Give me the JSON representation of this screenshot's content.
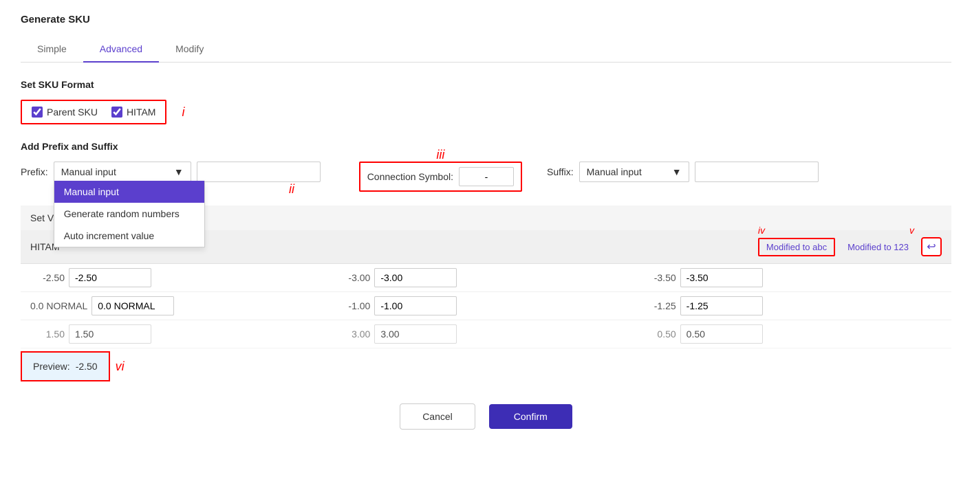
{
  "dialog": {
    "title": "Generate SKU"
  },
  "tabs": {
    "items": [
      {
        "id": "simple",
        "label": "Simple",
        "active": false
      },
      {
        "id": "advanced",
        "label": "Advanced",
        "active": true
      },
      {
        "id": "modify",
        "label": "Modify",
        "active": false
      }
    ]
  },
  "sku_format": {
    "title": "Set SKU Format",
    "checkboxes": [
      {
        "id": "parent-sku",
        "label": "Parent SKU",
        "checked": true
      },
      {
        "id": "hitam",
        "label": "HITAM",
        "checked": true
      }
    ],
    "roman": "i"
  },
  "prefix_suffix": {
    "title": "Add Prefix and Suffix",
    "prefix_label": "Prefix:",
    "prefix_options": [
      "Manual input",
      "Generate random numbers",
      "Auto increment value"
    ],
    "prefix_selected": "Manual input",
    "dropdown_items": [
      {
        "label": "Manual input",
        "selected": true
      },
      {
        "label": "Generate random numbers",
        "selected": false
      },
      {
        "label": "Auto increment value",
        "selected": false
      }
    ],
    "roman_ii": "ii",
    "connection_symbol_label": "Connection Symbol:",
    "connection_symbol_value": "-",
    "roman_iii": "iii",
    "suffix_label": "Suffix:",
    "suffix_options": [
      "Manual input",
      "Generate random numbers",
      "Auto increment value"
    ],
    "suffix_selected": "Manual input"
  },
  "set_variable": {
    "label": "Set Var"
  },
  "hitam_row": {
    "label": "HITAM",
    "modified_abc_label": "Modified to abc",
    "modified_123_label": "Modified to 123",
    "roman_iv": "iv",
    "roman_v": "v",
    "revert_icon": "↩"
  },
  "data_rows": [
    {
      "cells": [
        {
          "value": "-2.50",
          "input": "-2.50"
        },
        {
          "value": "-3.00",
          "input": "-3.00"
        },
        {
          "value": "-3.50",
          "input": "-3.50"
        }
      ]
    },
    {
      "cells": [
        {
          "value": "0.0 NORMAL",
          "input": "0.0 NORMAL"
        },
        {
          "value": "-1.00",
          "input": "-1.00"
        },
        {
          "value": "-1.25",
          "input": "-1.25"
        }
      ]
    },
    {
      "cells": [
        {
          "value": "1.50",
          "input": "1.50"
        },
        {
          "value": "3.00",
          "input": "3.00"
        },
        {
          "value": "0.50",
          "input": "0.50"
        }
      ]
    }
  ],
  "preview": {
    "label": "Preview:",
    "value": "-2.50",
    "roman": "vi"
  },
  "footer": {
    "cancel_label": "Cancel",
    "confirm_label": "Confirm"
  }
}
